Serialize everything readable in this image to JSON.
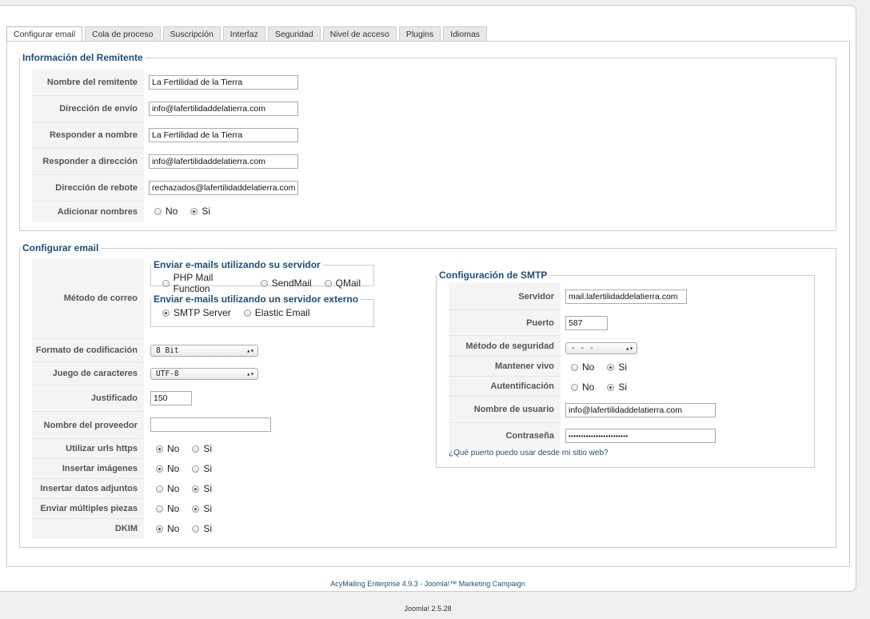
{
  "tabs": [
    "Configurar email",
    "Cola de proceso",
    "Suscripción",
    "Interfaz",
    "Seguridad",
    "Nivel de acceso",
    "Plugins",
    "Idiomas"
  ],
  "sender": {
    "legend": "Información del Remitente",
    "fields": [
      {
        "label": "Nombre del remitente",
        "value": "La Fertilidad de la Tierra"
      },
      {
        "label": "Dirección de envío",
        "value": "info@lafertilidaddelatierra.com"
      },
      {
        "label": "Responder a nombre",
        "value": "La Fertilidad de la Tierra"
      },
      {
        "label": "Responder a dirección",
        "value": "info@lafertilidaddelatierra.com"
      },
      {
        "label": "Dirección de rebote",
        "value": "rechazados@lafertilidaddelatierra.com"
      }
    ],
    "add_names": {
      "label": "Adicionar nombres",
      "no": "No",
      "yes": "Si",
      "selected": "yes"
    }
  },
  "email_config": {
    "legend": "Configurar email",
    "mail_method": {
      "label": "Método de correo",
      "own_server_legend": "Enviar e-mails utilizando su servidor",
      "own_server_options": [
        "PHP Mail Function",
        "SendMail",
        "QMail"
      ],
      "external_legend": "Enviar e-mails utilizando un servidor externo",
      "external_options": [
        "SMTP Server",
        "Elastic Email"
      ],
      "selected": "SMTP Server"
    },
    "encoding": {
      "label": "Formato de codificación",
      "value": "8 Bit"
    },
    "charset": {
      "label": "Juego de caracteres",
      "value": "UTF-8"
    },
    "justify": {
      "label": "Justificado",
      "value": "150"
    },
    "provider": {
      "label": "Nombre del proveedor",
      "value": ""
    },
    "radios": [
      {
        "label": "Utilizar urls https",
        "no": "No",
        "yes": "Si",
        "selected": "no"
      },
      {
        "label": "Insertar imágenes",
        "no": "No",
        "yes": "Si",
        "selected": "no"
      },
      {
        "label": "Insertar datos adjuntos",
        "no": "No",
        "yes": "Si",
        "selected": "yes"
      },
      {
        "label": "Enviar múltiples piezas",
        "no": "No",
        "yes": "Si",
        "selected": "yes"
      },
      {
        "label": "DKIM",
        "no": "No",
        "yes": "Si",
        "selected": "no"
      }
    ]
  },
  "smtp": {
    "legend": "Configuración de SMTP",
    "server": {
      "label": "Servidor",
      "value": "mail.lafertilidaddelatierra.com"
    },
    "port": {
      "label": "Puerto",
      "value": "587"
    },
    "security": {
      "label": "Método de seguridad",
      "value": "- - -"
    },
    "keepalive": {
      "label": "Mantener vivo",
      "no": "No",
      "yes": "Si",
      "selected": "yes"
    },
    "auth": {
      "label": "Autentificación",
      "no": "No",
      "yes": "Si",
      "selected": "yes"
    },
    "username": {
      "label": "Nombre de usuario",
      "value": "info@lafertilidaddelatierra.com"
    },
    "password": {
      "label": "Contraseña",
      "value": "••••••••••••••••••••••••"
    },
    "help_link": "¿Qué puerto puedo usar desde mi sitio web?"
  },
  "footer": {
    "credit": "AcyMailing Enterprise 4.9.3 - Joomla!™ Marketing Campaign",
    "version": "Joomla! 2.5.28"
  }
}
